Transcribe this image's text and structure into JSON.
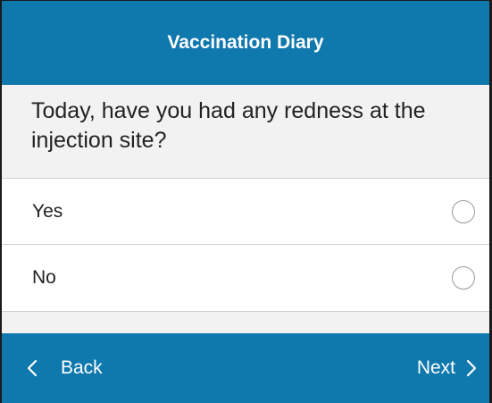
{
  "header": {
    "title": "Vaccination Diary"
  },
  "question": {
    "text": "Today, have you had any redness at the injection site?"
  },
  "options": [
    {
      "label": "Yes",
      "selected": false
    },
    {
      "label": "No",
      "selected": false
    }
  ],
  "footer": {
    "back_label": "Back",
    "back_icon": "chevron-left-icon",
    "next_label": "Next",
    "next_icon": "chevron-right-icon"
  },
  "colors": {
    "primary": "#0f78ad",
    "background": "#f2f2f2",
    "option_background": "#ffffff",
    "divider": "#cfcfcf"
  }
}
